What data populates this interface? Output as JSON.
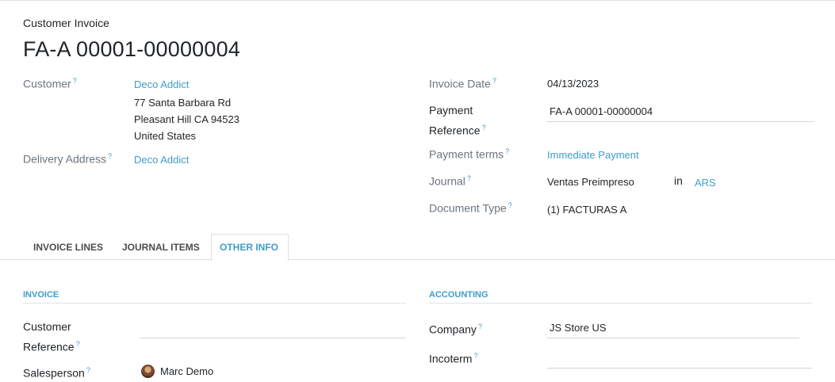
{
  "header": {
    "caption": "Customer Invoice",
    "title": "FA-A 00001-00000004"
  },
  "left": {
    "customer_label": "Customer",
    "customer_name": "Deco Addict",
    "address": [
      "77 Santa Barbara Rd",
      "Pleasant Hill CA 94523",
      "United States"
    ],
    "delivery_label": "Delivery Address",
    "delivery_value": "Deco Addict"
  },
  "right": {
    "invoice_date_label": "Invoice Date",
    "invoice_date_value": "04/13/2023",
    "payment_ref_label_1": "Payment",
    "payment_ref_label_2": "Reference",
    "payment_ref_value": "FA-A 00001-00000004",
    "payment_terms_label": "Payment terms",
    "payment_terms_value": "Immediate Payment",
    "journal_label": "Journal",
    "journal_value": "Ventas Preimpreso",
    "journal_in": "in",
    "journal_currency": "ARS",
    "doc_type_label": "Document Type",
    "doc_type_value": "(1) FACTURAS A"
  },
  "tabs": [
    {
      "label": "INVOICE LINES",
      "active": false
    },
    {
      "label": "JOURNAL ITEMS",
      "active": false
    },
    {
      "label": "OTHER INFO",
      "active": true
    }
  ],
  "other_info": {
    "invoice_section": "INVOICE",
    "customer_ref_label_1": "Customer",
    "customer_ref_label_2": "Reference",
    "customer_ref_value": "",
    "salesperson_label": "Salesperson",
    "salesperson_value": "Marc Demo",
    "accounting_section": "ACCOUNTING",
    "company_label": "Company",
    "company_value": "JS Store US",
    "incoterm_label": "Incoterm",
    "incoterm_value": ""
  },
  "help_marker": "?",
  "colors": {
    "accent": "#3f9ccb",
    "text": "#212529",
    "muted": "#6c757d"
  }
}
